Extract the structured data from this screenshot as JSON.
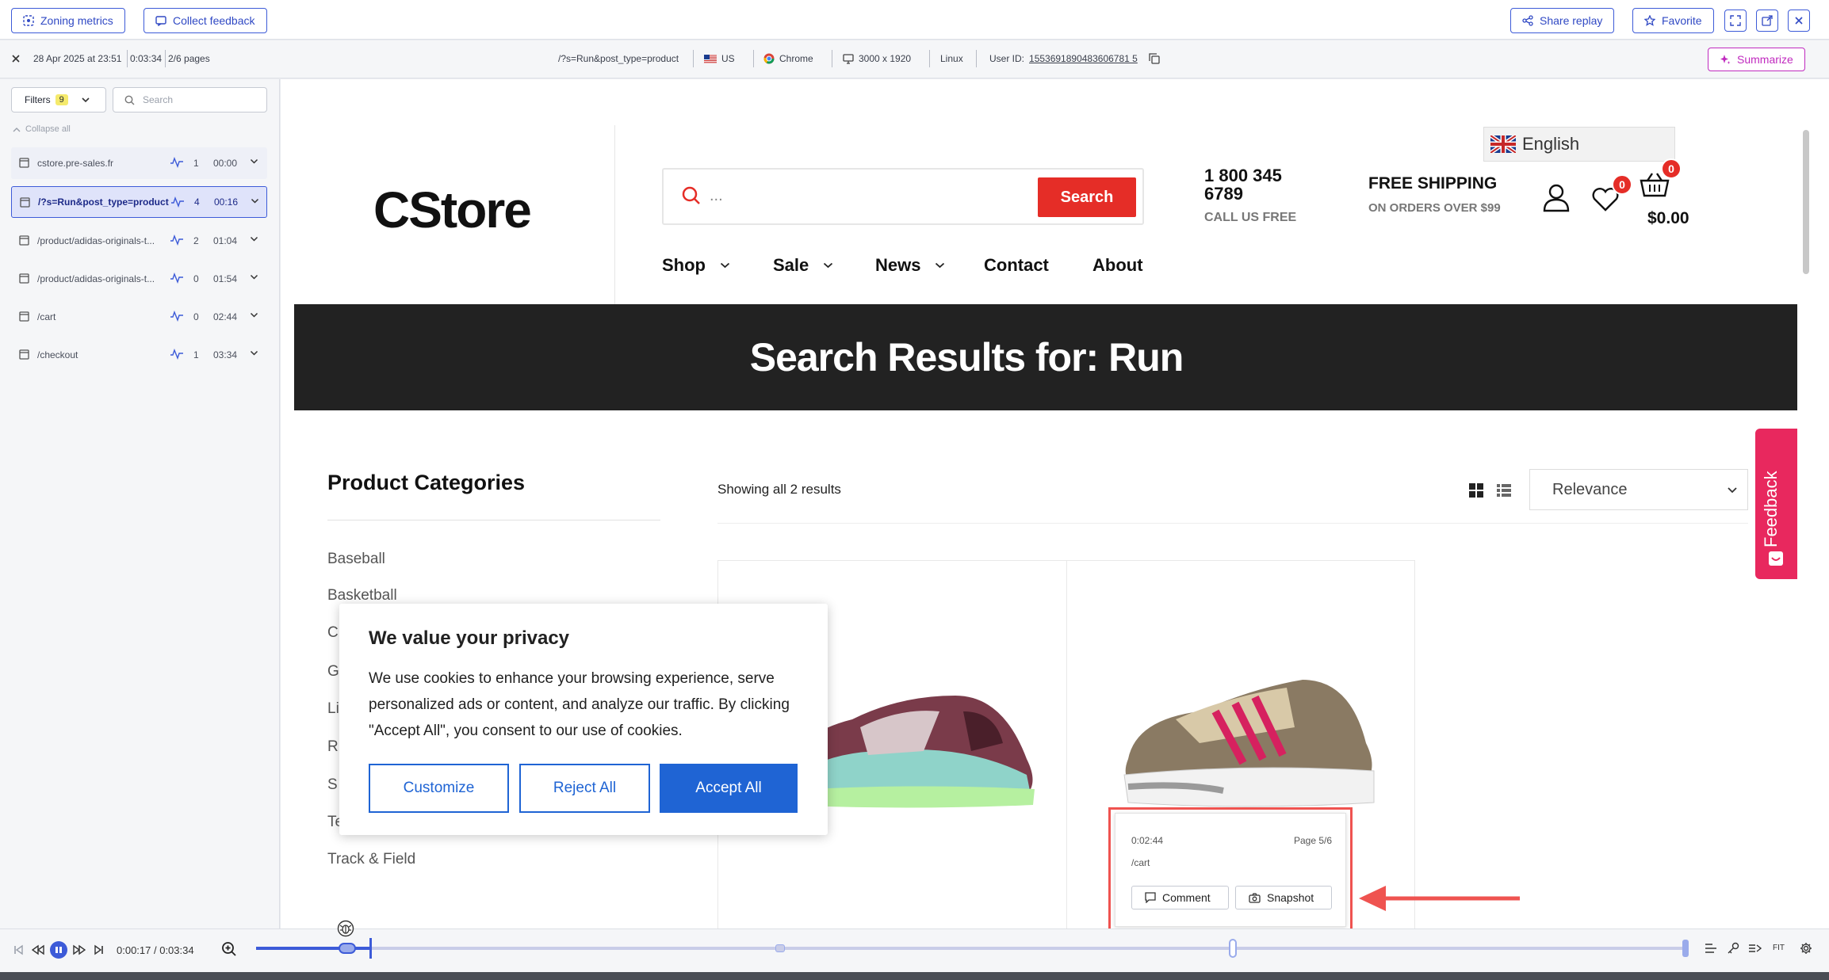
{
  "toolbar": {
    "zoning_label": "Zoning metrics",
    "feedback_label": "Collect feedback",
    "share_label": "Share replay",
    "favorite_label": "Favorite",
    "summarize_label": "Summarize"
  },
  "session": {
    "date": "28 Apr 2025 at 23:51",
    "duration": "0:03:34",
    "pages": "2/6 pages",
    "url": "/?s=Run&post_type=product",
    "country": "US",
    "browser": "Chrome",
    "resolution": "3000 x 1920",
    "os": "Linux",
    "user_id_label": "User ID:",
    "user_id": "1553691890483606781 5"
  },
  "sidebar": {
    "filters_label": "Filters",
    "filters_count": "9",
    "search_placeholder": "Search",
    "collapse_label": "Collapse all",
    "pages": [
      {
        "path": "cstore.pre-sales.fr",
        "count": "1",
        "time": "00:00"
      },
      {
        "path": "/?s=Run&post_type=product",
        "count": "4",
        "time": "00:16"
      },
      {
        "path": "/product/adidas-originals-t...",
        "count": "2",
        "time": "01:04"
      },
      {
        "path": "/product/adidas-originals-t...",
        "count": "0",
        "time": "01:54"
      },
      {
        "path": "/cart",
        "count": "0",
        "time": "02:44"
      },
      {
        "path": "/checkout",
        "count": "1",
        "time": "03:34"
      }
    ]
  },
  "site": {
    "logo": "CStore",
    "search_button": "Search",
    "search_placeholder": "...",
    "phone": "1 800 345 6789",
    "call_label": "CALL US FREE",
    "shipping_title": "FREE SHIPPING",
    "shipping_sub": "ON ORDERS OVER $99",
    "language": "English",
    "wishlist_count": "0",
    "cart_count": "0",
    "cart_total": "$0.00",
    "nav": [
      "Shop",
      "Sale",
      "News",
      "Contact",
      "About"
    ],
    "banner_title": "Search Results for: Run",
    "categories_title": "Product Categories",
    "categories": [
      "Baseball",
      "Basketball",
      "C",
      "G",
      "Li",
      "R",
      "S",
      "Te",
      "Track & Field"
    ],
    "results_text": "Showing all 2 results",
    "sort_value": "Relevance",
    "feedback_tab": "Feedback"
  },
  "cookie": {
    "title": "We value your privacy",
    "body": "We use cookies to enhance your browsing experience, serve personalized ads or content, and analyze our traffic. By clicking \"Accept All\", you consent to our use of cookies.",
    "customize": "Customize",
    "reject": "Reject All",
    "accept": "Accept All"
  },
  "popover": {
    "time": "0:02:44",
    "page": "Page 5/6",
    "path": "/cart",
    "comment_label": "Comment",
    "snapshot_label": "Snapshot"
  },
  "player": {
    "time_display": "0:00:17 / 0:03:34",
    "fit_label": "FIT",
    "progress": 0.079
  },
  "colors": {
    "accent": "#3d5bd8",
    "summarize": "#c02abf",
    "site_red": "#e52d27",
    "highlight": "#ef5350",
    "feedback_tab": "#e8285e"
  }
}
